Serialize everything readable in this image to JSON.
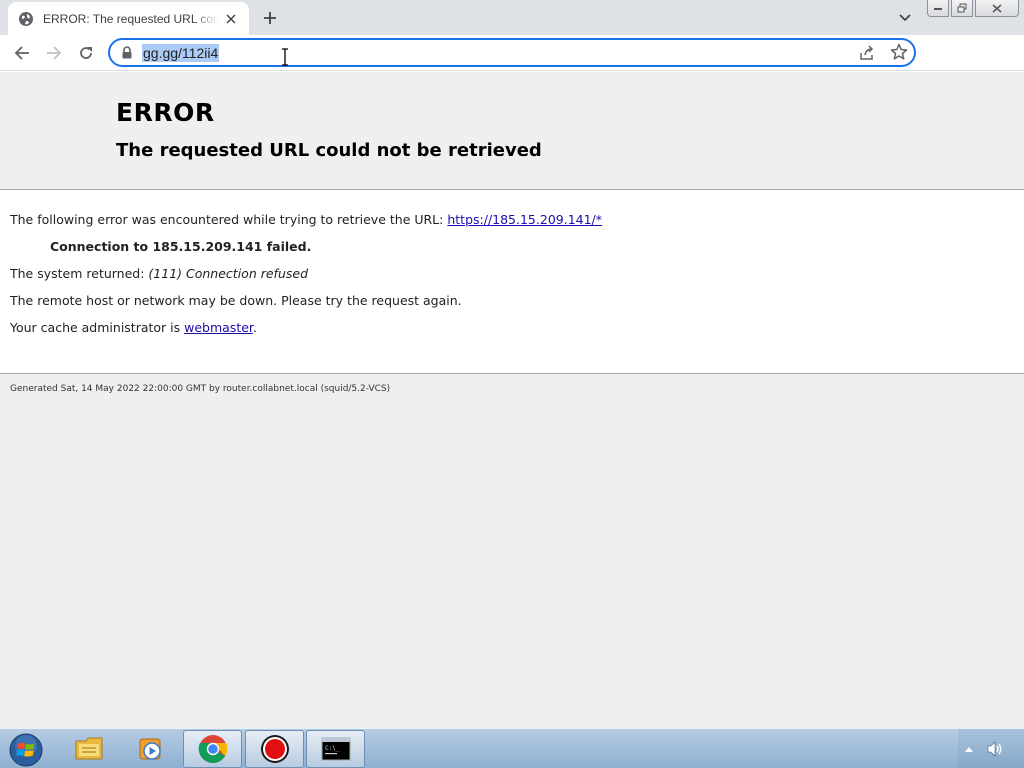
{
  "browser": {
    "tab": {
      "title": "ERROR: The requested URL could not be retrieved",
      "icon": "globe-icon"
    },
    "address_bar": {
      "url": "gg.gg/112ii4",
      "icon": "lock-icon"
    }
  },
  "page": {
    "heading": "ERROR",
    "subheading": "The requested URL could not be retrieved",
    "line1_text": "The following error was encountered while trying to retrieve the URL: ",
    "line1_link": "https://185.15.209.141/*",
    "line2_bold": "Connection to 185.15.209.141 failed.",
    "line3_text": "The system returned: ",
    "line3_em": "(111) Connection refused",
    "line4_text": "The remote host or network may be down. Please try the request again.",
    "line5_text": "Your cache administrator is ",
    "line5_link": "webmaster",
    "line5_end": ".",
    "footer": "Generated Sat, 14 May 2022 22:00:00 GMT by router.collabnet.local (squid/5.2-VCS)"
  },
  "taskbar": {
    "items": [
      "start-orb",
      "file-explorer",
      "media-player",
      "chrome",
      "recorder",
      "command-prompt"
    ],
    "active": "chrome"
  }
}
